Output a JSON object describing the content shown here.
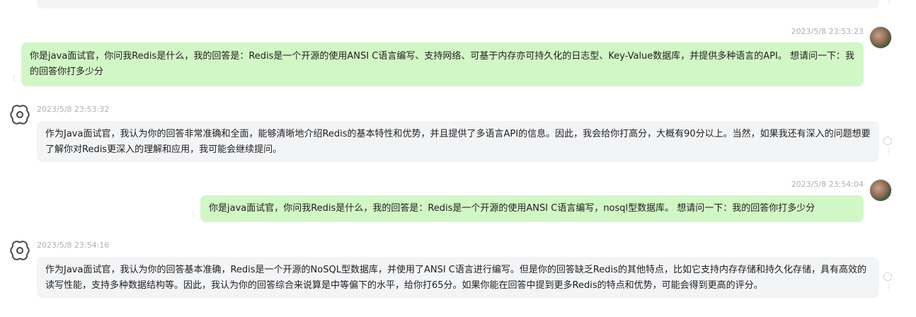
{
  "conversation": {
    "top_partial": {
      "text": ""
    },
    "messages": [
      {
        "role": "user",
        "timestamp": "2023/5/8 23:53:23",
        "text": "你是java面试官，你问我Redis是什么，我的回答是：Redis是一个开源的使用ANSI C语言编写、支持网络、可基于内存亦可持久化的日志型、Key-Value数据库，并提供多种语言的API。 想请问一下：我的回答你打多少分"
      },
      {
        "role": "assistant",
        "timestamp": "2023/5/8 23:53:32",
        "text": "作为Java面试官，我认为你的回答非常准确和全面，能够清晰地介绍Redis的基本特性和优势，并且提供了多语言API的信息。因此，我会给你打高分，大概有90分以上。当然，如果我还有深入的问题想要了解你对Redis更深入的理解和应用，我可能会继续提问。"
      },
      {
        "role": "user",
        "timestamp": "2023/5/8 23:54:04",
        "text": "你是java面试官，你问我Redis是什么，我的回答是：Redis是一个开源的使用ANSI C语言编写，nosql型数据库。 想请问一下：我的回答你打多少分"
      },
      {
        "role": "assistant",
        "timestamp": "2023/5/8 23:54:16",
        "text": "作为Java面试官，我认为你的回答基本准确，Redis是一个开源的NoSQL型数据库，并使用了ANSI C语言进行编写。但是你的回答缺乏Redis的其他特点，比如它支持内存存储和持久化存储，具有高效的读写性能，支持多种数据结构等。因此，我认为你的回答综合来说算是中等偏下的水平，给你打65分。如果你能在回答中提到更多Redis的特点和优势，可能会得到更高的评分。"
      }
    ]
  },
  "colors": {
    "user_bubble": "#d2f7c6",
    "assistant_bubble": "#f3f4f6",
    "timestamp": "#b0b0b0"
  },
  "icons": {
    "assistant_avatar": "openai-logo-icon",
    "user_avatar": "user-avatar",
    "more": "vertical-dots-icon",
    "regenerate": "refresh-icon"
  }
}
